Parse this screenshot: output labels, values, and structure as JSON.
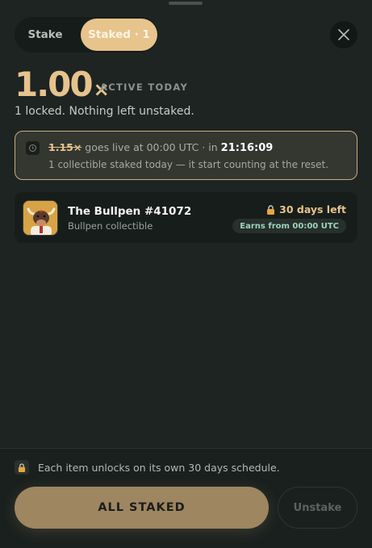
{
  "tabs": [
    {
      "label": "Stake",
      "active": false
    },
    {
      "label": "Staked · 1",
      "active": true
    }
  ],
  "multiplier": {
    "value": "1.00",
    "symbol": "×",
    "label": "ACTIVE TODAY",
    "summary": "1 locked. Nothing left unstaked."
  },
  "notice": {
    "upcoming_multiplier": "1.15×",
    "text_mid": " goes live at 00:00 UTC · in ",
    "countdown": "21:16:09",
    "detail": "1 collectible staked today — it start counting at the reset."
  },
  "staked_items": [
    {
      "title": "The Bullpen #41072",
      "subtitle": "Bullpen collectible",
      "days_left": "30 days left",
      "earns": "Earns from 00:00 UTC"
    }
  ],
  "footer": {
    "info": "Each item unlocks on its own 30 days schedule.",
    "primary_button": "ALL STAKED",
    "secondary_button": "Unstake"
  },
  "colors": {
    "accent": "#e6c38d",
    "background": "#1d2422",
    "earns_green": "#9fd4b9"
  },
  "icons": {
    "close": "close-icon",
    "lock": "lock-icon",
    "clock": "clock-icon"
  }
}
